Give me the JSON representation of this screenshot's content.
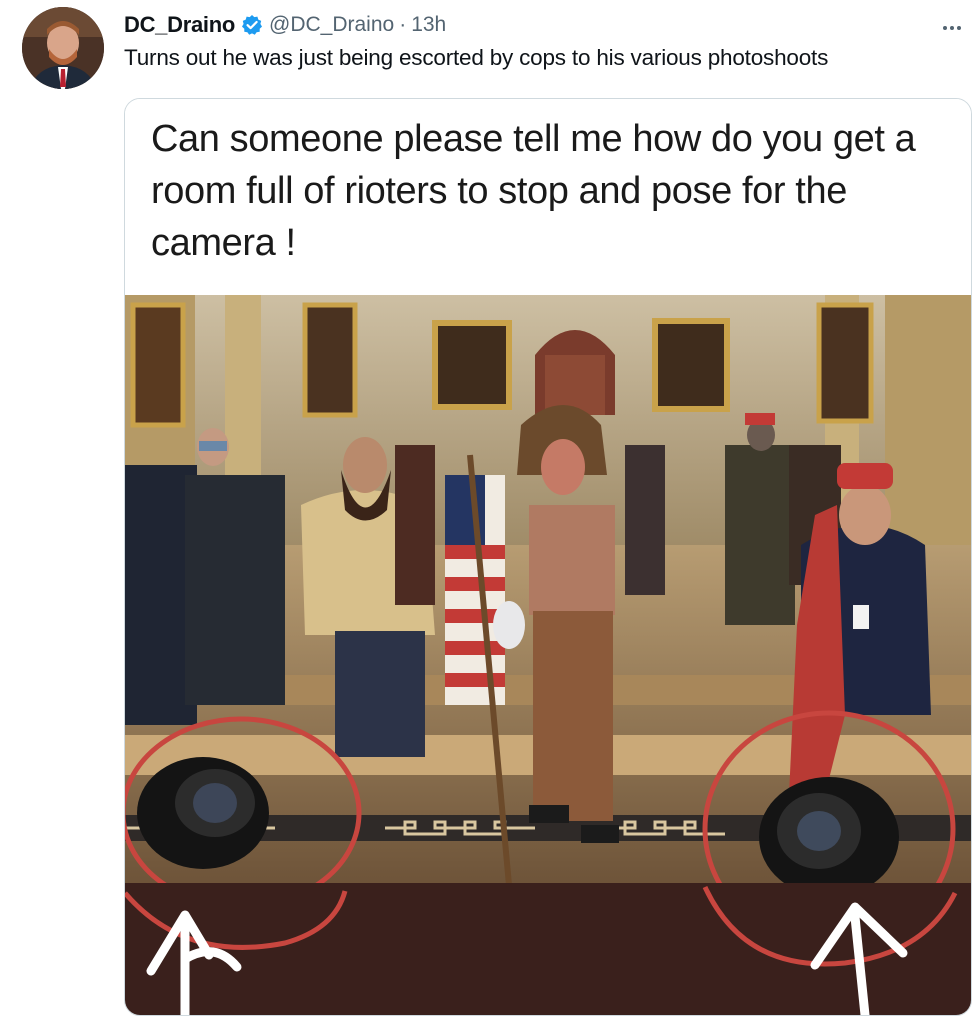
{
  "tweet": {
    "display_name": "DC_Draino",
    "verified_icon": "verified-badge-icon",
    "handle": "@DC_Draino",
    "separator": "·",
    "time": "13h",
    "text": "Turns out he was just being escorted by cops to his various photoshoots",
    "more_icon": "more-options-icon"
  },
  "media": {
    "caption": "Can someone please tell me how do you get a room full of rioters to stop and pose for the camera !"
  },
  "colors": {
    "verified": "#1d9bf0",
    "secondary_text": "#536471",
    "annotation_red": "#c8463f",
    "annotation_white": "#ffffff"
  }
}
